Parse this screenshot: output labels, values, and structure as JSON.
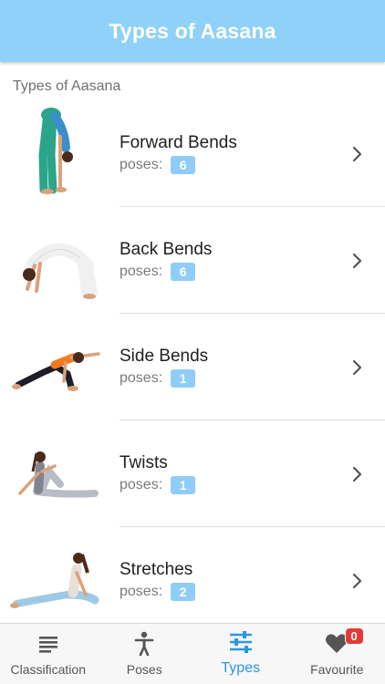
{
  "header": {
    "title": "Types of Aasana"
  },
  "section": {
    "title": "Types of Aasana"
  },
  "types": [
    {
      "name": "Forward Bends",
      "poses_label": "poses:",
      "count": "6",
      "icon": "forward-bend-pose-image"
    },
    {
      "name": "Back Bends",
      "poses_label": "poses:",
      "count": "6",
      "icon": "back-bend-pose-image"
    },
    {
      "name": "Side Bends",
      "poses_label": "poses:",
      "count": "1",
      "icon": "side-bend-pose-image"
    },
    {
      "name": "Twists",
      "poses_label": "poses:",
      "count": "1",
      "icon": "twist-pose-image"
    },
    {
      "name": "Stretches",
      "poses_label": "poses:",
      "count": "2",
      "icon": "stretch-pose-image"
    }
  ],
  "tabs": [
    {
      "label": "Classification",
      "icon": "list-icon"
    },
    {
      "label": "Poses",
      "icon": "person-icon"
    },
    {
      "label": "Types",
      "icon": "sliders-icon"
    },
    {
      "label": "Favourite",
      "icon": "heart-icon",
      "badge": "0"
    }
  ],
  "colors": {
    "header": "#8fd1f9",
    "badge": "#8fcdf7",
    "active_tab": "#2b97e4",
    "notification": "#e53935"
  }
}
